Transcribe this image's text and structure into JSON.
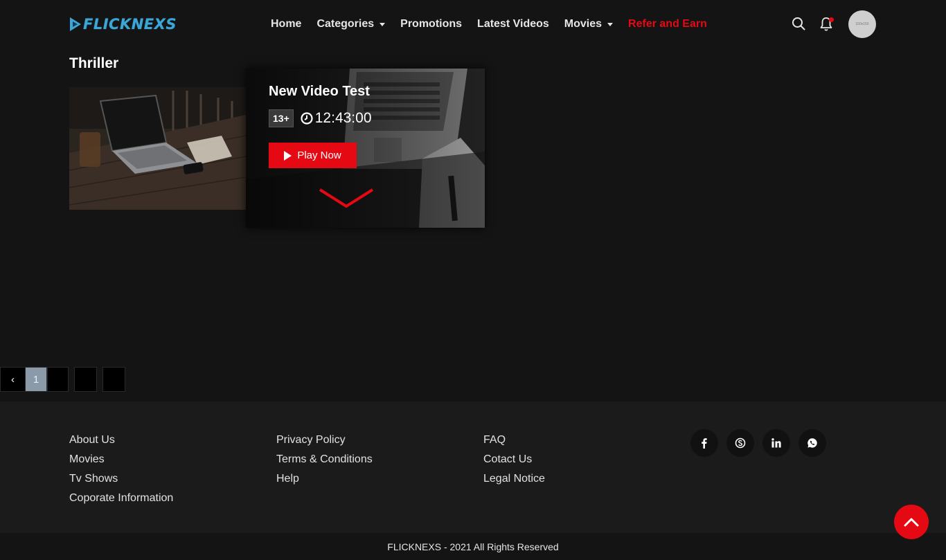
{
  "brand": {
    "name": "FLICKNEXS",
    "accent_color": "#e50914",
    "logo_color": "#3da6d6"
  },
  "nav": {
    "items": [
      {
        "label": "Home",
        "dropdown": false
      },
      {
        "label": "Categories",
        "dropdown": true
      },
      {
        "label": "Promotions",
        "dropdown": false
      },
      {
        "label": "Latest Videos",
        "dropdown": false
      },
      {
        "label": "Movies",
        "dropdown": true
      },
      {
        "label": "Refer and Earn",
        "dropdown": false,
        "highlight": true
      }
    ],
    "icons": [
      "search-icon",
      "bell-icon"
    ],
    "avatar_text": "150x150"
  },
  "section": {
    "title": "Thriller",
    "video": {
      "title": "New Video Test",
      "rating": "13+",
      "duration": "12:43:00",
      "play_label": "Play Now"
    }
  },
  "pagination": {
    "prev_label": "‹",
    "current": "1"
  },
  "footer": {
    "col1": [
      "About Us",
      "Movies",
      "Tv Shows",
      "Coporate Information"
    ],
    "col2": [
      "Privacy Policy",
      "Terms & Conditions",
      "Help"
    ],
    "col3": [
      "FAQ",
      "Cotact Us",
      "Legal Notice"
    ],
    "social": [
      "facebook-icon",
      "skype-icon",
      "linkedin-icon",
      "whatsapp-icon"
    ],
    "copyright": "FLICKNEXS - 2021 All Rights Reserved"
  }
}
